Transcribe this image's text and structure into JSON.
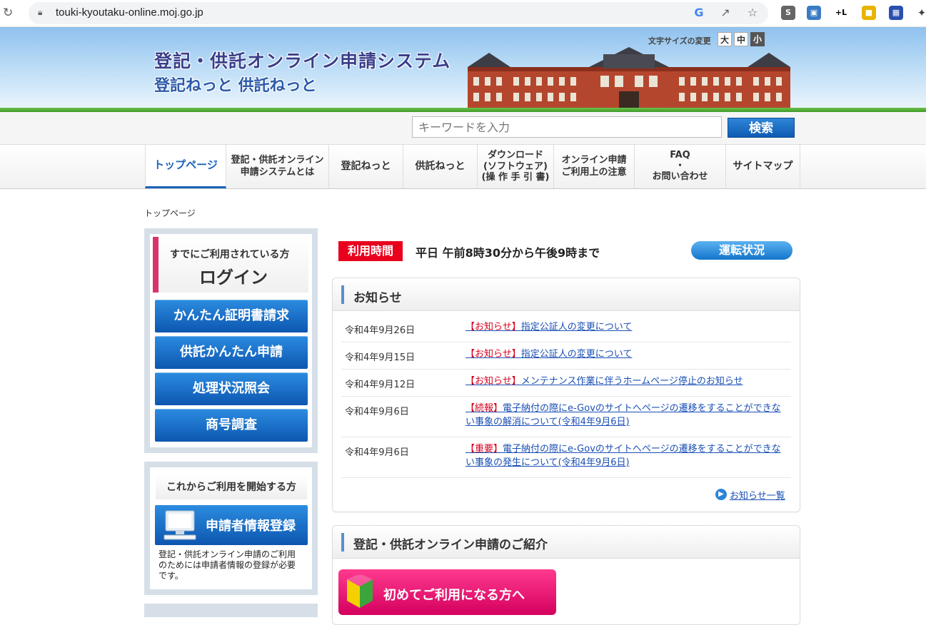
{
  "browser": {
    "url": "touki-kyoutaku-online.moj.go.jp"
  },
  "header": {
    "title": "登記・供託オンライン申請システム",
    "subtitle": "登記ねっと 供託ねっと",
    "font_size_label": "文字サイズの変更",
    "font_sizes": [
      "大",
      "中",
      "小"
    ]
  },
  "search": {
    "placeholder": "キーワードを入力",
    "button": "検索"
  },
  "nav": {
    "items": [
      "トップページ",
      "登記・供託オンライン\n申請システムとは",
      "登記ねっと",
      "供託ねっと",
      "ダウンロード\n(ソフトウェア)\n(操 作 手 引 書)",
      "オンライン申請\nご利用上の注意",
      "FAQ\n・\nお問い合わせ",
      "サイトマップ"
    ]
  },
  "breadcrumb": "トップページ",
  "sidebar": {
    "login_sub": "すでにご利用されている方",
    "login_main": "ログイン",
    "buttons": [
      "かんたん証明書請求",
      "供託かんたん申請",
      "処理状況照会",
      "商号調査"
    ],
    "start_heading": "これからご利用を開始する方",
    "register_button": "申請者情報登録",
    "register_note": "登記・供託オンライン申請のご利用のためには申請者情報の登録が必要です。"
  },
  "hours": {
    "badge": "利用時間",
    "text": "平日 午前8時30分から午後9時まで",
    "status_button": "運転状況"
  },
  "news": {
    "title": "お知らせ",
    "items": [
      {
        "date": "令和4年9月26日",
        "tag": "【お知らせ】",
        "text": "指定公証人の変更について"
      },
      {
        "date": "令和4年9月15日",
        "tag": "【お知らせ】",
        "text": "指定公証人の変更について"
      },
      {
        "date": "令和4年9月12日",
        "tag": "【お知らせ】",
        "text": "メンテナンス作業に伴うホームページ停止のお知らせ"
      },
      {
        "date": "令和4年9月6日",
        "tag": "【続報】",
        "text": "電子納付の際にe-Govのサイトへページの遷移をすることができない事象の解消について(令和4年9月6日)"
      },
      {
        "date": "令和4年9月6日",
        "tag": "【重要】",
        "text": "電子納付の際にe-Govのサイトへページの遷移をすることができない事象の発生について(令和4年9月6日)"
      }
    ],
    "more": "お知らせ一覧"
  },
  "intro": {
    "title": "登記・供託オンライン申請のご紹介",
    "first_button": "初めてご利用になる方へ"
  },
  "colors": {
    "accent_blue": "#1a63b8",
    "alert_red": "#e8001c",
    "pink": "#d8336b"
  }
}
